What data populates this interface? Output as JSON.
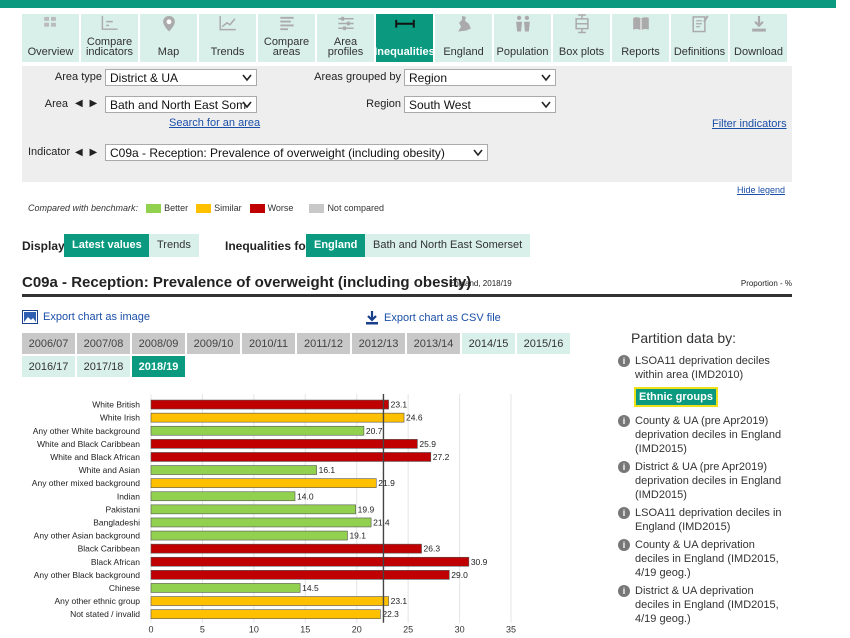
{
  "nav": {
    "tabs": [
      {
        "label": "Overview",
        "icon": "overview-icon"
      },
      {
        "label": "Compare indicators",
        "icon": "compare-indicators-icon"
      },
      {
        "label": "Map",
        "icon": "map-pin-icon"
      },
      {
        "label": "Trends",
        "icon": "trends-icon"
      },
      {
        "label": "Compare areas",
        "icon": "compare-areas-icon"
      },
      {
        "label": "Area profiles",
        "icon": "area-profiles-icon"
      },
      {
        "label": "Inequalities",
        "icon": "inequalities-icon"
      },
      {
        "label": "England",
        "icon": "england-icon"
      },
      {
        "label": "Population",
        "icon": "population-icon"
      },
      {
        "label": "Box plots",
        "icon": "box-plots-icon"
      },
      {
        "label": "Reports",
        "icon": "reports-icon"
      },
      {
        "label": "Definitions",
        "icon": "definitions-icon"
      },
      {
        "label": "Download",
        "icon": "download-icon"
      }
    ],
    "active": "Inequalities"
  },
  "filters": {
    "area_type_label": "Area type",
    "area_type_value": "District & UA",
    "grouped_label": "Areas grouped by",
    "grouped_value": "Region",
    "area_label": "Area",
    "area_value": "Bath and North East Som",
    "region_label": "Region",
    "region_value": "South West",
    "search_link": "Search for an area",
    "filter_link": "Filter indicators",
    "indicator_label": "Indicator",
    "indicator_value": "C09a - Reception: Prevalence of overweight (including obesity)"
  },
  "legend": {
    "hide_link": "Hide legend",
    "prefix": "Compared with benchmark:",
    "items": [
      {
        "label": "Better",
        "color": "#92d050"
      },
      {
        "label": "Similar",
        "color": "#ffc000"
      },
      {
        "label": "Worse",
        "color": "#c00000"
      },
      {
        "label": "Not compared",
        "color": "#c8c8c8"
      }
    ]
  },
  "display": {
    "label": "Display",
    "latest": "Latest values",
    "trends": "Trends",
    "ineq_label": "Inequalities for",
    "england": "England",
    "area": "Bath and North East Somerset"
  },
  "chart_header": {
    "title": "C09a - Reception: Prevalence of overweight (including obesity)",
    "subtitle": "England, 2018/19",
    "unit": "Proportion - %"
  },
  "exports": {
    "image": "Export chart as image",
    "csv": "Export chart as CSV file"
  },
  "years": [
    "2006/07",
    "2007/08",
    "2008/09",
    "2009/10",
    "2010/11",
    "2011/12",
    "2012/13",
    "2013/14",
    "2014/15",
    "2015/16",
    "2016/17",
    "2017/18",
    "2018/19"
  ],
  "years_available_from": "2014/15",
  "year_selected": "2018/19",
  "partition": {
    "title": "Partition data by:",
    "items": [
      "LSOA11 deprivation deciles within area (IMD2010)",
      "Ethnic groups",
      "County & UA (pre Apr2019) deprivation deciles in England (IMD2015)",
      "District & UA (pre Apr2019) deprivation deciles in England (IMD2015)",
      "LSOA11 deprivation deciles in England (IMD2015)",
      "County & UA deprivation deciles in England (IMD2015, 4/19 geog.)",
      "District & UA deprivation deciles in England (IMD2015, 4/19 geog.)"
    ],
    "selected": "Ethnic groups"
  },
  "chart_data": {
    "type": "bar",
    "orientation": "horizontal",
    "categories": [
      "White British",
      "White Irish",
      "Any other White background",
      "White and Black Caribbean",
      "White and Black African",
      "White and Asian",
      "Any other mixed background",
      "Indian",
      "Pakistani",
      "Bangladeshi",
      "Any other Asian background",
      "Black Caribbean",
      "Black African",
      "Any other Black background",
      "Chinese",
      "Any other ethnic group",
      "Not stated / invalid"
    ],
    "values": [
      23.1,
      24.6,
      20.7,
      25.9,
      27.2,
      16.1,
      21.9,
      14.0,
      19.9,
      21.4,
      19.1,
      26.3,
      30.9,
      29.0,
      14.5,
      23.1,
      22.3
    ],
    "comparison": [
      "Worse",
      "Similar",
      "Better",
      "Worse",
      "Worse",
      "Better",
      "Similar",
      "Better",
      "Better",
      "Better",
      "Better",
      "Worse",
      "Worse",
      "Worse",
      "Better",
      "Similar",
      "Similar"
    ],
    "benchmark": 22.6,
    "xlim": [
      0,
      35
    ],
    "xticks": [
      0,
      5,
      10,
      15,
      20,
      25,
      30,
      35
    ],
    "colors": {
      "Better": "#92d050",
      "Similar": "#ffc000",
      "Worse": "#c00000"
    },
    "grid": true
  }
}
